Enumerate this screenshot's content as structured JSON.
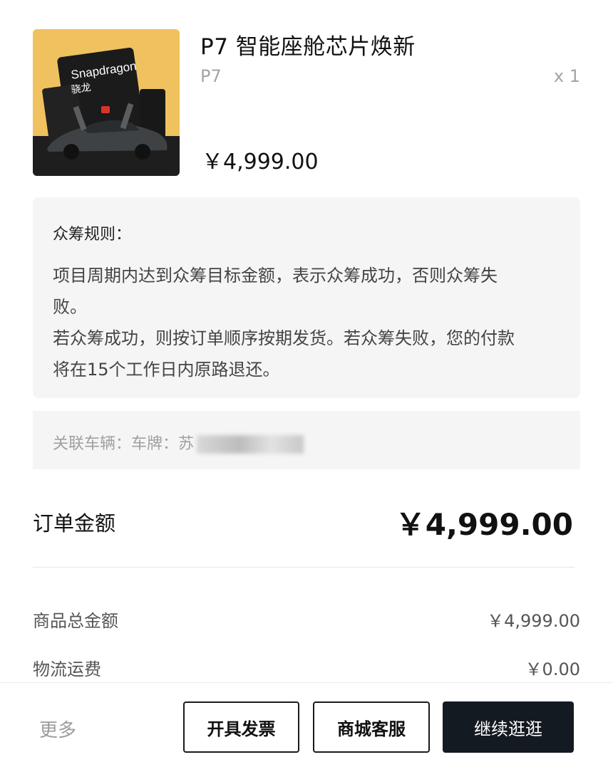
{
  "product": {
    "title": "P7 智能座舱芯片焕新",
    "variant": "P7",
    "quantity": "x 1",
    "price": "￥4,999.00",
    "image_text": "Snapdragon 骁龙"
  },
  "rules": {
    "title": "众筹规则：",
    "lines": [
      "项目周期内达到众筹目标金额，表示众筹成功，否则众筹失",
      "败。",
      "若众筹成功，则按订单顺序按期发货。若众筹失败，您的付款",
      "将在15个工作日内原路退还。"
    ]
  },
  "vehicle": {
    "label": "关联车辆：车牌：苏"
  },
  "order": {
    "label": "订单金额",
    "total": "￥4,999.00"
  },
  "summary": {
    "goods_label": "商品总金额",
    "goods_value": "￥4,999.00",
    "shipping_label": "物流运费",
    "shipping_value": "￥0.00"
  },
  "bottom_bar": {
    "more": "更多",
    "invoice": "开具发票",
    "service": "商城客服",
    "continue": "继续逛逛"
  },
  "colors": {
    "primary_button": "#141a22",
    "panel_bg": "#f5f5f5",
    "thumb_gold": "#f2c86a"
  }
}
